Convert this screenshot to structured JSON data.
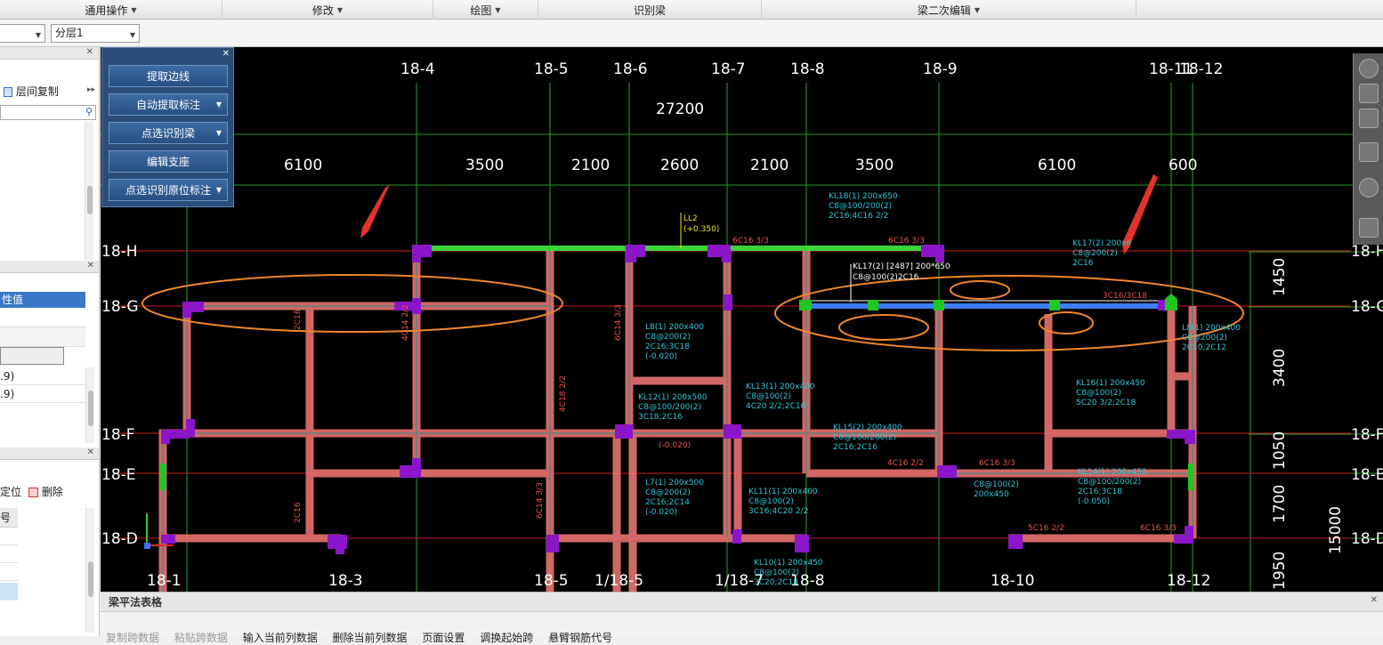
{
  "menu": {
    "groups": [
      {
        "label": "通用操作",
        "caret": true
      },
      {
        "label": "修改",
        "caret": true
      },
      {
        "label": "绘图",
        "caret": true
      },
      {
        "label": "识别梁",
        "caret": false
      },
      {
        "label": "梁二次编辑",
        "caret": true
      }
    ]
  },
  "toolbar": {
    "floor_select": "",
    "layer_select": "分层1"
  },
  "left_panel": {
    "copy_label": "层间复制",
    "prop_header": "性值",
    "values": [
      ".9)",
      ".9)"
    ],
    "locate_label": "定位",
    "delete_label": "删除",
    "col_header": "号"
  },
  "float_panel": {
    "buttons": [
      {
        "label": "提取边线",
        "caret": false
      },
      {
        "label": "自动提取标注",
        "caret": true
      },
      {
        "label": "点选识别梁",
        "caret": true
      },
      {
        "label": "编辑支座",
        "caret": false
      },
      {
        "label": "点选识别原位标注",
        "caret": true
      }
    ]
  },
  "cad": {
    "top_axes": [
      "18-4",
      "18-5",
      "18-6",
      "18-7",
      "18-8",
      "18-9",
      "18-11",
      "18-12"
    ],
    "overall_dim": "27200",
    "dims": [
      "6100",
      "3500",
      "2100",
      "2600",
      "2100",
      "3500",
      "6100",
      "600"
    ],
    "row_axes_left": [
      "18-H",
      "18-G",
      "18-F",
      "18-E",
      "18-D"
    ],
    "row_axes_right": [
      "18-H",
      "18-G",
      "18-F",
      "18-E",
      "18-D"
    ],
    "right_dims": [
      "1450",
      "3400",
      "1050",
      "1700",
      "1950"
    ],
    "right_total": "15000",
    "bottom_axes": [
      "18-1",
      "18-3",
      "18-5",
      "1/18-5",
      "1/18-7",
      "18-8",
      "18-10",
      "18-12"
    ],
    "annotations_cyan": [
      "KL18(1) 200x650",
      "C8@100/200(2)",
      "2C16;4C16 2/2",
      "KL17(2) 200x6",
      "C8@200(2)",
      "2C16",
      "L8(1) 200x400",
      "C8@200(2)",
      "2C16;3C18",
      "(-0.020)",
      "KL12(1) 200x500",
      "C8@100/200(2)",
      "3C18;2C16",
      "KL13(1) 200x400",
      "C8@100(2)",
      "4C20 2/2;2C16",
      "KL15(2) 200x400",
      "C8@100/200(2)",
      "2C16;2C16",
      "KL16(1) 200x450",
      "C8@100(2)",
      "5C20 3/2;2C18",
      "KL14(1) 200x450",
      "C8@100/200(2)",
      "2C16;3C18",
      "(-0.050)",
      "L7(1) 200x500",
      "C8@200(2)",
      "2C16;2C14",
      "(-0.020)",
      "KL11(1) 200x400",
      "C8@100(2)",
      "3C16;4C20 2/2",
      "KL10(1) 200x450",
      "C8@100(2)",
      "3C20;2C18",
      "L8(1) 200x400",
      "C8@200(2)",
      "2C10;2C12",
      "C8@100(2)",
      "200x450"
    ],
    "annotations_red": [
      "6C16 3/3",
      "6C16 3/3",
      "3C16/3C18",
      "4C16 2/2",
      "6C16 3/3",
      "5C16 2/2",
      "6C16 3/3",
      "2C16",
      "4C14 2/2",
      "4C18 2/2",
      "6C14 3/3",
      "2C16",
      "6C14 3/3",
      "(-0.020)"
    ],
    "annotations_yellow": [
      "LL2",
      "(+0.350)"
    ],
    "selected_label": "KL17(2) [2487] 200*650",
    "selected_sub": "C8@100(2)2C16"
  },
  "bottom": {
    "title": "梁平法表格",
    "tools": [
      "复制跨数据",
      "粘贴跨数据",
      "输入当前列数据",
      "删除当前列数据",
      "页面设置",
      "调换起始跨",
      "悬臂钢筋代号"
    ],
    "disabled": [
      true,
      true,
      false,
      false,
      false,
      false,
      false
    ]
  }
}
